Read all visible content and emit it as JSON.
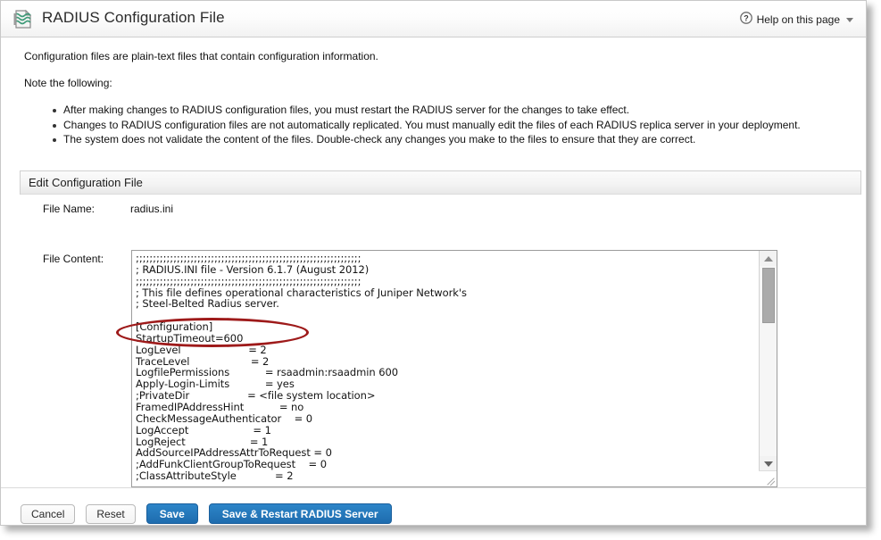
{
  "window": {
    "title": "RADIUS Configuration File",
    "title_icon": "config-file-icon",
    "help": {
      "label": "Help on this page",
      "icon": "question-mark-icon",
      "caret_icon": "chevron-down-icon"
    }
  },
  "intro": {
    "paragraph": "Configuration files are plain-text files that contain configuration information.",
    "note_heading": "Note the following:",
    "notes": [
      "After making changes to RADIUS configuration files, you must restart the RADIUS server for the changes to take effect.",
      "Changes to RADIUS configuration files are not automatically replicated. You must manually edit the files of each RADIUS replica server in your deployment.",
      "The system does not validate the content of the files. Double-check any changes you make to the files to ensure that they are correct."
    ]
  },
  "section": {
    "header": "Edit Configuration File",
    "file_name_label": "File Name:",
    "file_name_value": "radius.ini",
    "file_content_label": "File Content:",
    "file_content_value": ";;;;;;;;;;;;;;;;;;;;;;;;;;;;;;;;;;;;;;;;;;;;;;;;;;;;;;;;;;;;;;;;;;\n; RADIUS.INI file - Version 6.1.7 (August 2012)\n;;;;;;;;;;;;;;;;;;;;;;;;;;;;;;;;;;;;;;;;;;;;;;;;;;;;;;;;;;;;;;;;;;\n; This file defines operational characteristics of Juniper Network's\n; Steel-Belted Radius server.\n\n[Configuration]\nStartupTimeout=600\nLogLevel                     = 2\nTraceLevel                   = 2\nLogfilePermissions           = rsaadmin:rsaadmin 600\nApply-Login-Limits           = yes\n;PrivateDir                  = <file system location>\nFramedIPAddressHint           = no\nCheckMessageAuthenticator    = 0\nLogAccept                    = 1\nLogReject                    = 1\nAddSourceIPAddressAttrToRequest = 0\n;AddFunkClientGroupToRequest    = 0\n;ClassAttributeStyle            = 2"
  },
  "annotation": {
    "type": "ellipse-highlight",
    "color": "#9e1a1a",
    "targets": [
      "LogLevel",
      "TraceLevel"
    ]
  },
  "buttons": {
    "cancel": "Cancel",
    "reset": "Reset",
    "save": "Save",
    "save_restart": "Save & Restart RADIUS Server",
    "primary_color": "#1e6cae"
  }
}
